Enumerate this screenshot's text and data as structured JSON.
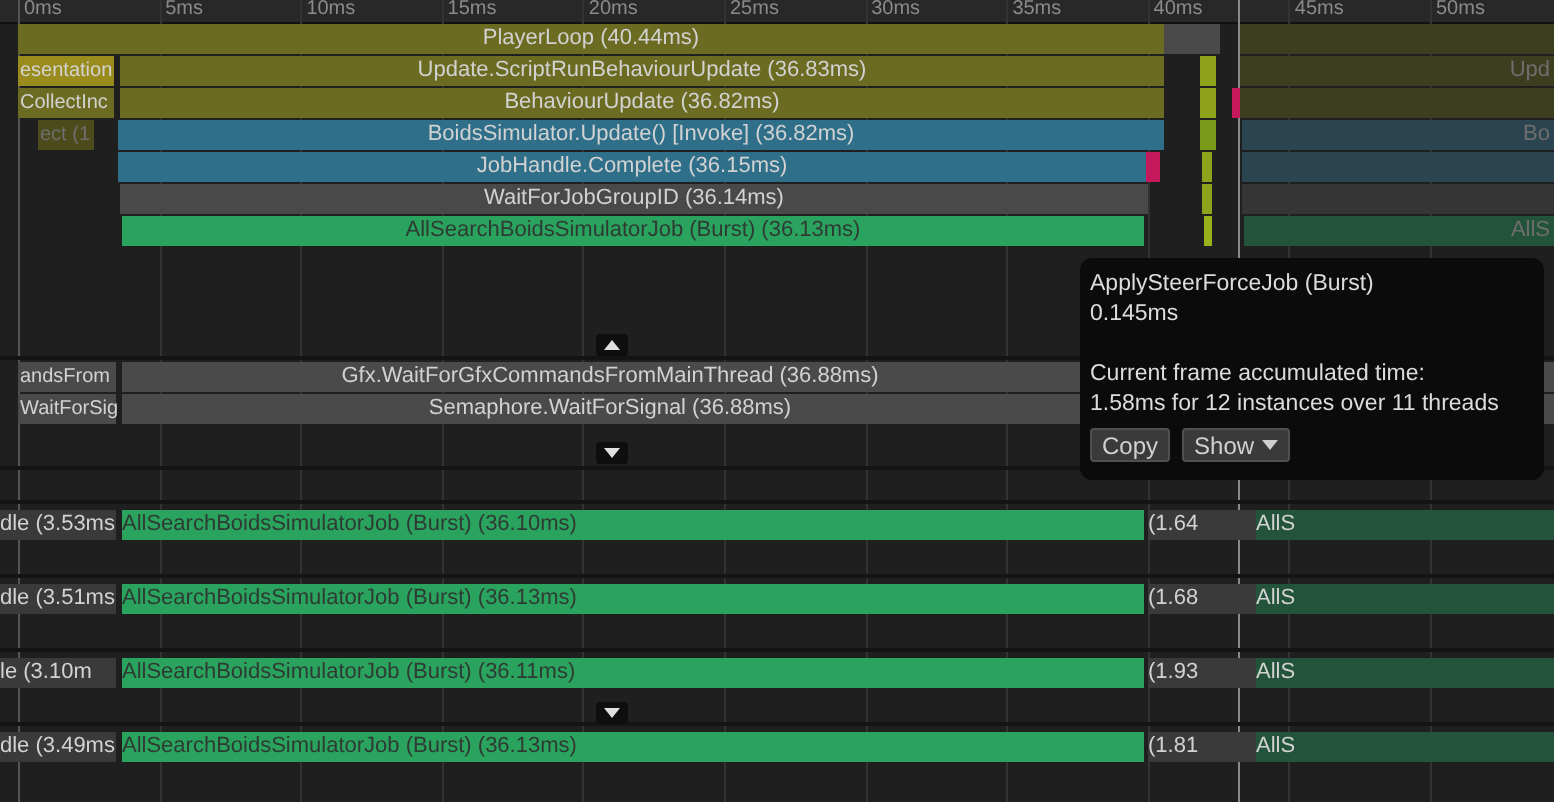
{
  "ruler": {
    "ticks": [
      "0ms",
      "5ms",
      "10ms",
      "15ms",
      "20ms",
      "25ms",
      "30ms",
      "35ms",
      "40ms",
      "45ms",
      "50ms"
    ]
  },
  "main_thread": {
    "bars": [
      {
        "label": "PlayerLoop (40.44ms)",
        "color": "#6b6b22"
      },
      {
        "label": "esentation",
        "color": "#9a8c1c"
      },
      {
        "label": "Update.ScriptRunBehaviourUpdate (36.83ms)",
        "color": "#6b6b22"
      },
      {
        "label": "CollectInc",
        "color": "#6b6b22"
      },
      {
        "label": "BehaviourUpdate (36.82ms)",
        "color": "#6b6b22"
      },
      {
        "label": "ect (1",
        "color": "#4b4b1c"
      },
      {
        "label": "BoidsSimulator.Update() [Invoke] (36.82ms)",
        "color": "#2f6f89"
      },
      {
        "label": "JobHandle.Complete (36.15ms)",
        "color": "#2f6f89"
      },
      {
        "label": "WaitForJobGroupID (36.14ms)",
        "color": "#494949"
      },
      {
        "label": "AllSearchBoidsSimulatorJob (Burst) (36.13ms)",
        "color": "#2aa35f"
      },
      {
        "color": "#3d3d20"
      },
      {
        "label": "Upd",
        "color": "#3d3d20"
      },
      {
        "color": "#3d3d20"
      },
      {
        "label": "Bo",
        "color": "#2a4450"
      },
      {
        "color": "#2a4450"
      },
      {
        "color": "#353535"
      },
      {
        "label": "AllS",
        "color": "#23533a"
      },
      {
        "color": "#4a4a4a"
      },
      {
        "color": "#c41a5c"
      },
      {
        "color": "#c41a5c"
      },
      {
        "color": "#8ea21c"
      },
      {
        "color": "#8ea21c"
      },
      {
        "color": "#7a9a1a"
      },
      {
        "color": "#8ea21c"
      },
      {
        "color": "#8ea21c"
      },
      {
        "color": "#9ab01c"
      }
    ]
  },
  "render_thread": {
    "bars": [
      {
        "label": "andsFrom",
        "color": "#4a4a4a"
      },
      {
        "label": "Gfx.WaitForGfxCommandsFromMainThread (36.88ms)",
        "color": "#4a4a4a"
      },
      {
        "color": "#4a4a4a"
      },
      {
        "label": "WaitForSig",
        "color": "#4a4a4a"
      },
      {
        "label": "Semaphore.WaitForSignal (36.88ms)",
        "color": "#4a4a4a"
      },
      {
        "color": "#4a4a4a"
      }
    ]
  },
  "workers": [
    {
      "bars": [
        {
          "label": "dle (3.53ms",
          "color": "#3a3a3a"
        },
        {
          "label": "AllSearchBoidsSimulatorJob (Burst) (36.10ms)",
          "color": "#2aa35f"
        },
        {
          "label": "(1.64",
          "color": "#3a3a3a"
        },
        {
          "label": "AllS",
          "color": "#23533a"
        }
      ]
    },
    {
      "bars": [
        {
          "label": "dle (3.51ms",
          "color": "#3a3a3a"
        },
        {
          "label": "AllSearchBoidsSimulatorJob (Burst) (36.13ms)",
          "color": "#2aa35f"
        },
        {
          "label": "(1.68",
          "color": "#3a3a3a"
        },
        {
          "label": "AllS",
          "color": "#23533a"
        }
      ]
    },
    {
      "bars": [
        {
          "label": "le (3.10m",
          "color": "#3a3a3a"
        },
        {
          "label": "AllSearchBoidsSimulatorJob (Burst) (36.11ms)",
          "color": "#2aa35f"
        },
        {
          "label": "(1.93",
          "color": "#3a3a3a"
        },
        {
          "label": "AllS",
          "color": "#23533a"
        }
      ]
    },
    {
      "bars": [
        {
          "label": "dle (3.49ms",
          "color": "#3a3a3a"
        },
        {
          "label": "AllSearchBoidsSimulatorJob (Burst) (36.13ms)",
          "color": "#2aa35f"
        },
        {
          "label": "(1.81",
          "color": "#3a3a3a"
        },
        {
          "label": "AllS",
          "color": "#23533a"
        }
      ]
    }
  ],
  "toggles": [
    {
      "kind": "up"
    },
    {
      "kind": "down"
    },
    {
      "kind": "down"
    }
  ],
  "tooltip": {
    "title": "ApplySteerForceJob (Burst)",
    "duration": "0.145ms",
    "summary_label": "Current frame accumulated time:",
    "summary_value": "1.58ms for 12 instances over 11 threads",
    "buttons": [
      {
        "label": "Copy",
        "kind": "plain"
      },
      {
        "label": "Show",
        "kind": "dropdown"
      }
    ]
  }
}
